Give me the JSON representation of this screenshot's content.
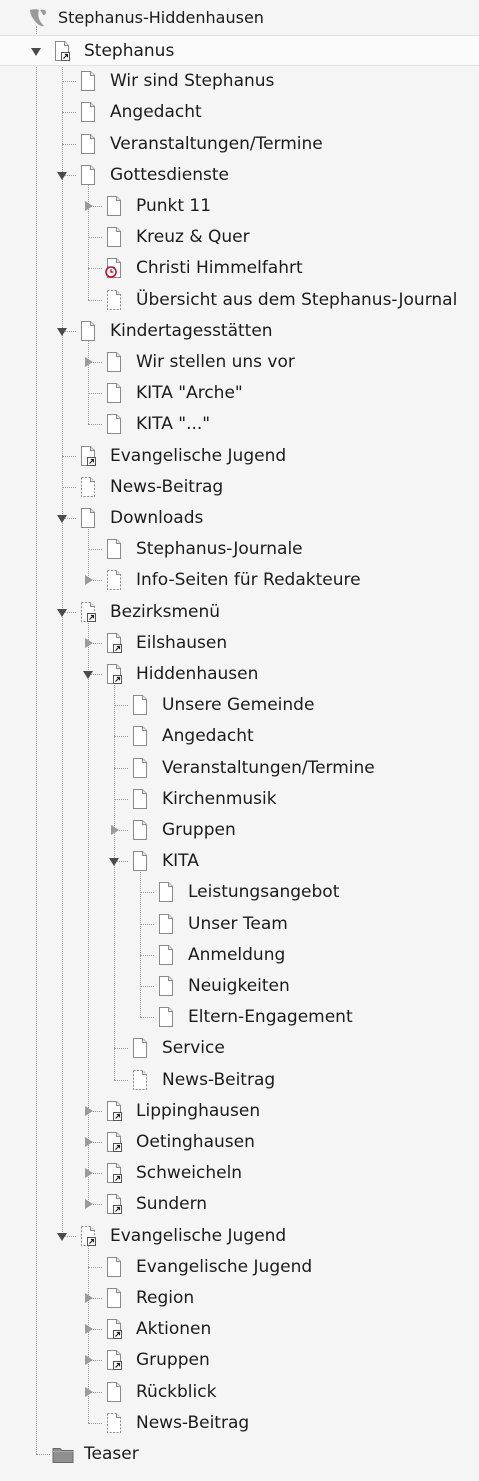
{
  "tree": {
    "root": {
      "label": "Stephanus-Hiddenhausen",
      "icon": "typo3-logo-icon"
    },
    "items": [
      {
        "id": "stephanus",
        "label": "Stephanus",
        "depth": 0,
        "icon": "shortcut-page-icon",
        "state": "open",
        "selected": true
      },
      {
        "id": "wir-sind",
        "label": "Wir sind Stephanus",
        "depth": 1,
        "icon": "page-icon",
        "state": "none"
      },
      {
        "id": "angedacht",
        "label": "Angedacht",
        "depth": 1,
        "icon": "page-icon",
        "state": "none"
      },
      {
        "id": "veranstaltungen",
        "label": "Veranstaltungen/Termine",
        "depth": 1,
        "icon": "page-icon",
        "state": "none"
      },
      {
        "id": "gottesdienste",
        "label": "Gottesdienste",
        "depth": 1,
        "icon": "page-icon",
        "state": "open"
      },
      {
        "id": "punkt11",
        "label": "Punkt 11",
        "depth": 2,
        "icon": "page-icon",
        "state": "closed"
      },
      {
        "id": "kreuz",
        "label": "Kreuz & Quer",
        "depth": 2,
        "icon": "page-icon",
        "state": "none"
      },
      {
        "id": "himmelfahrt",
        "label": "Christi Himmelfahrt",
        "depth": 2,
        "icon": "scheduled-page-icon",
        "state": "none"
      },
      {
        "id": "uebersicht",
        "label": "Übersicht aus dem Stephanus-Journal",
        "depth": 2,
        "icon": "hidden-page-icon",
        "state": "none"
      },
      {
        "id": "kitas",
        "label": "Kindertagesstätten",
        "depth": 1,
        "icon": "page-icon",
        "state": "open"
      },
      {
        "id": "wirstellen",
        "label": "Wir stellen uns vor",
        "depth": 2,
        "icon": "page-icon",
        "state": "closed"
      },
      {
        "id": "kita-arche",
        "label": "KITA \"Arche\"",
        "depth": 2,
        "icon": "page-icon",
        "state": "none"
      },
      {
        "id": "kita-dots",
        "label": "KITA \"...\"",
        "depth": 2,
        "icon": "page-icon",
        "state": "none"
      },
      {
        "id": "evjugend1",
        "label": "Evangelische Jugend",
        "depth": 1,
        "icon": "shortcut-page-icon",
        "state": "none"
      },
      {
        "id": "news1",
        "label": "News-Beitrag",
        "depth": 1,
        "icon": "hidden-page-icon",
        "state": "none"
      },
      {
        "id": "downloads",
        "label": "Downloads",
        "depth": 1,
        "icon": "page-icon",
        "state": "open"
      },
      {
        "id": "journale",
        "label": "Stephanus-Journale",
        "depth": 2,
        "icon": "page-icon",
        "state": "none"
      },
      {
        "id": "infoseiten",
        "label": "Info-Seiten für Redakteure",
        "depth": 2,
        "icon": "hidden-page-icon",
        "state": "closed"
      },
      {
        "id": "bezirksmenue",
        "label": "Bezirksmenü",
        "depth": 1,
        "icon": "hidden-shortcut-page-icon",
        "state": "open"
      },
      {
        "id": "eilshausen",
        "label": "Eilshausen",
        "depth": 2,
        "icon": "shortcut-page-icon",
        "state": "closed"
      },
      {
        "id": "hiddenhausen",
        "label": "Hiddenhausen",
        "depth": 2,
        "icon": "shortcut-page-icon",
        "state": "open"
      },
      {
        "id": "unsere-gemeinde",
        "label": "Unsere Gemeinde",
        "depth": 3,
        "icon": "page-icon",
        "state": "none"
      },
      {
        "id": "angedacht2",
        "label": "Angedacht",
        "depth": 3,
        "icon": "page-icon",
        "state": "none"
      },
      {
        "id": "veranstaltungen2",
        "label": "Veranstaltungen/Termine",
        "depth": 3,
        "icon": "page-icon",
        "state": "none"
      },
      {
        "id": "kirchenmusik",
        "label": "Kirchenmusik",
        "depth": 3,
        "icon": "page-icon",
        "state": "none"
      },
      {
        "id": "gruppen1",
        "label": "Gruppen",
        "depth": 3,
        "icon": "page-icon",
        "state": "closed"
      },
      {
        "id": "kita",
        "label": "KITA",
        "depth": 3,
        "icon": "page-icon",
        "state": "open"
      },
      {
        "id": "leistungsangebot",
        "label": "Leistungsangebot",
        "depth": 4,
        "icon": "page-icon",
        "state": "none"
      },
      {
        "id": "unser-team",
        "label": "Unser Team",
        "depth": 4,
        "icon": "page-icon",
        "state": "none"
      },
      {
        "id": "anmeldung",
        "label": "Anmeldung",
        "depth": 4,
        "icon": "page-icon",
        "state": "none"
      },
      {
        "id": "neuigkeiten",
        "label": "Neuigkeiten",
        "depth": 4,
        "icon": "page-icon",
        "state": "none"
      },
      {
        "id": "eltern",
        "label": "Eltern-Engagement",
        "depth": 4,
        "icon": "page-icon",
        "state": "none"
      },
      {
        "id": "service",
        "label": "Service",
        "depth": 3,
        "icon": "page-icon",
        "state": "none"
      },
      {
        "id": "news2",
        "label": "News-Beitrag",
        "depth": 3,
        "icon": "hidden-page-icon",
        "state": "none"
      },
      {
        "id": "lippinghausen",
        "label": "Lippinghausen",
        "depth": 2,
        "icon": "shortcut-page-icon",
        "state": "closed"
      },
      {
        "id": "oetinghausen",
        "label": "Oetinghausen",
        "depth": 2,
        "icon": "shortcut-page-icon",
        "state": "closed"
      },
      {
        "id": "schweicheln",
        "label": "Schweicheln",
        "depth": 2,
        "icon": "shortcut-page-icon",
        "state": "closed"
      },
      {
        "id": "sundern",
        "label": "Sundern",
        "depth": 2,
        "icon": "shortcut-page-icon",
        "state": "closed"
      },
      {
        "id": "evjugend2",
        "label": "Evangelische Jugend",
        "depth": 1,
        "icon": "hidden-shortcut-page-icon",
        "state": "open"
      },
      {
        "id": "evjugend3",
        "label": "Evangelische Jugend",
        "depth": 2,
        "icon": "page-icon",
        "state": "none"
      },
      {
        "id": "region",
        "label": "Region",
        "depth": 2,
        "icon": "page-icon",
        "state": "closed"
      },
      {
        "id": "aktionen",
        "label": "Aktionen",
        "depth": 2,
        "icon": "shortcut-page-icon",
        "state": "closed"
      },
      {
        "id": "gruppen2",
        "label": "Gruppen",
        "depth": 2,
        "icon": "shortcut-page-icon",
        "state": "closed"
      },
      {
        "id": "rueckblick",
        "label": "Rückblick",
        "depth": 2,
        "icon": "page-icon",
        "state": "closed"
      },
      {
        "id": "news3",
        "label": "News-Beitrag",
        "depth": 2,
        "icon": "hidden-page-icon",
        "state": "none"
      },
      {
        "id": "teaser",
        "label": "Teaser",
        "depth": 0,
        "icon": "folder-icon",
        "state": "none"
      }
    ]
  },
  "colors": {
    "background": "#f5f5f5",
    "text": "#1b1b1b",
    "tree_line": "#9a9a9a",
    "scheduled": "#c8102e",
    "typo3": "#9a9a9a"
  }
}
